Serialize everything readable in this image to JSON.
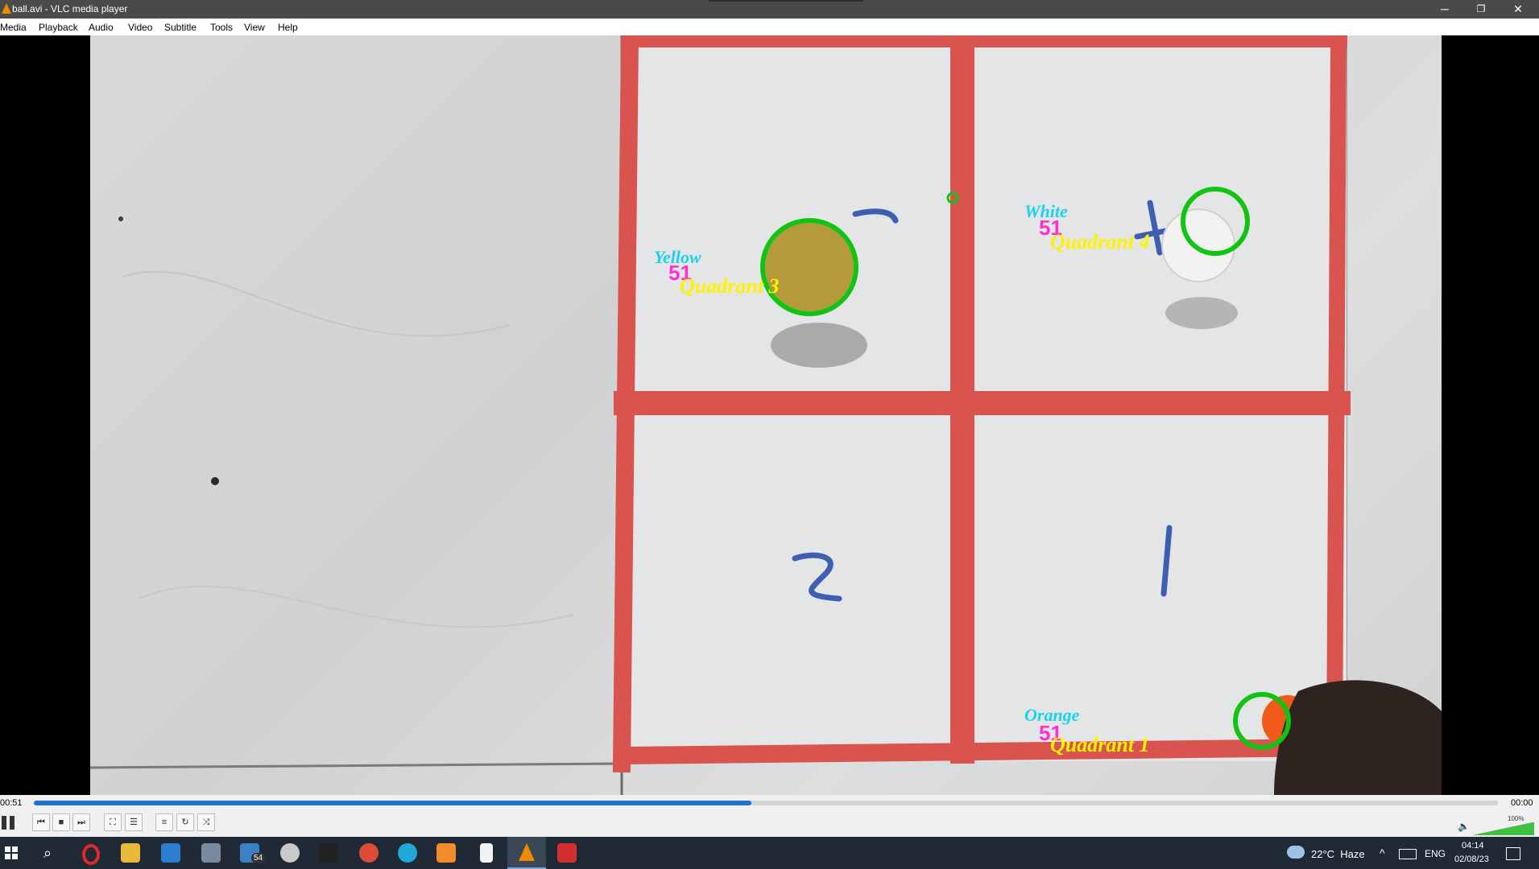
{
  "window": {
    "title": "ball.avi - VLC media player",
    "minimize": "─",
    "restore": "❐",
    "close": "✕"
  },
  "menu": {
    "items": [
      "Media",
      "Playback",
      "Audio",
      "Video",
      "Subtitle",
      "Tools",
      "View",
      "Help"
    ]
  },
  "video_overlay": {
    "q3": {
      "name": "Yellow",
      "count": "51",
      "quadrant": "Quadrant 3",
      "drawn_digit": "3"
    },
    "q4": {
      "name": "White",
      "count": "51",
      "quadrant": "Quadrant 4",
      "drawn_digit": "4"
    },
    "q1": {
      "name": "Orange",
      "count": "51",
      "quadrant": "Quadrant 1"
    },
    "drawn_digit_2": "2",
    "drawn_digit_1": "1"
  },
  "player": {
    "elapsed": "00:51",
    "remaining": "00:00",
    "progress_fraction": 0.49,
    "volume": "100%",
    "volume_fraction": 1.0
  },
  "taskbar": {
    "mail_badge": "54",
    "weather": "22°C  Haze",
    "lang": "ENG",
    "time": "04:14",
    "date": "02/08/23"
  },
  "colors": {
    "tape": "#d9534f",
    "circle": "#12c412",
    "label_cyan": "#19d3ee",
    "label_magenta": "#ff2fd2",
    "label_yellow": "#fff200",
    "seek": "#1e73d2"
  }
}
